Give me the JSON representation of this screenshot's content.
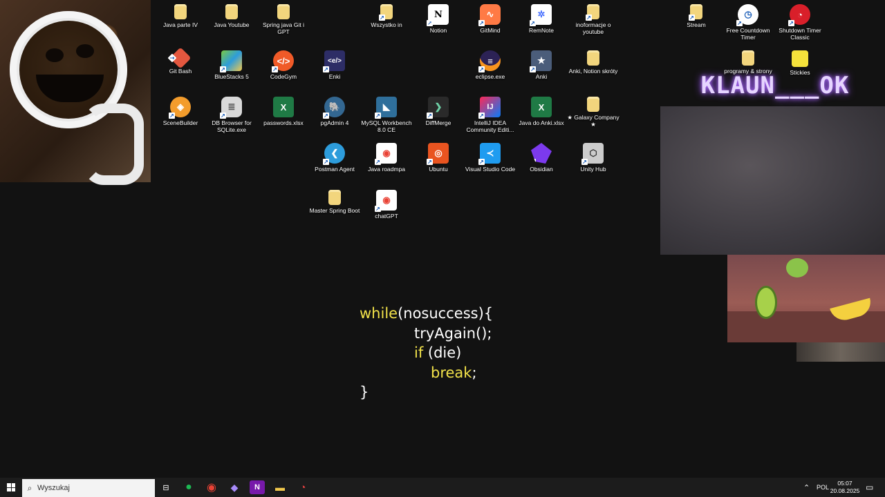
{
  "desktop": {
    "icons": [
      {
        "label": "Java parte IV",
        "color": "#f2d57d"
      },
      {
        "label": "Java Youtube",
        "color": "#f2d57d"
      },
      {
        "label": "Spring java Git i GPT",
        "color": "#f2d57d"
      },
      {
        "label": "Wszystko in",
        "color": "#f2d57d"
      },
      {
        "label": "Notion",
        "color": "#ffffff"
      },
      {
        "label": "GitMind",
        "color": "#ff7a45"
      },
      {
        "label": "RemNote",
        "color": "#ffffff"
      },
      {
        "label": "inoformacje o youtube",
        "color": "#f2d57d"
      },
      {
        "label": "Stream",
        "color": "#f2d57d"
      },
      {
        "label": "Free Countdown Timer",
        "color": "#ffffff"
      },
      {
        "label": "Shutdown Timer Classic",
        "color": "#d91f2a"
      },
      {
        "label": "Git Bash",
        "color": "#e3573f"
      },
      {
        "label": "BlueStacks 5",
        "color": "#7ac943"
      },
      {
        "label": "CodeGym",
        "color": "#f05a28"
      },
      {
        "label": "Enki",
        "color": "#2d2d66"
      },
      {
        "label": "eclipse.exe",
        "color": "#2c2255"
      },
      {
        "label": "Anki",
        "color": "#4b5d7a"
      },
      {
        "label": "Anki, Notion skróty",
        "color": "#f2d57d"
      },
      {
        "label": "programy & strony",
        "color": "#f2d57d"
      },
      {
        "label": "Stickies",
        "color": "#f5e23b"
      },
      {
        "label": "SceneBuilder",
        "color": "#f39c2c"
      },
      {
        "label": "DB Browser for SQLite.exe",
        "color": "#d9d9d9"
      },
      {
        "label": "passwords.xlsx",
        "color": "#1f7a45"
      },
      {
        "label": "pgAdmin 4",
        "color": "#336791"
      },
      {
        "label": "MySQL Workbench 8.0 CE",
        "color": "#2f6f9b"
      },
      {
        "label": "DiffMerge",
        "color": "#444444"
      },
      {
        "label": "IntelliJ IDEA Community Editi...",
        "color": "#fe2857"
      },
      {
        "label": "Java do Anki.xlsx",
        "color": "#1f7a45"
      },
      {
        "label": "★ Galaxy Company ★",
        "color": "#f2d57d"
      },
      {
        "label": "Postman Agent",
        "color": "#2d9cdb"
      },
      {
        "label": "Java roadmpa",
        "color": "#ffffff"
      },
      {
        "label": "Ubuntu",
        "color": "#e95420"
      },
      {
        "label": "Visual Studio Code",
        "color": "#1f9cf0"
      },
      {
        "label": "Obsidian",
        "color": "#7c3aed"
      },
      {
        "label": "Unity Hub",
        "color": "#cccccc"
      },
      {
        "label": "Master Spring Boot",
        "color": "#f2d57d"
      },
      {
        "label": "chatGPT",
        "color": "#ffffff"
      }
    ]
  },
  "overlay": {
    "neon_text": "KLAUN___OK"
  },
  "code": {
    "l1_kw": "while",
    "l1_rest": "(nosuccess){",
    "l2": "tryAgain();",
    "l3_kw": "if",
    "l3_rest": " (die)",
    "l4_kw": "break",
    "l4_rest": ";",
    "l5": "}"
  },
  "taskbar": {
    "search_placeholder": "Wyszukaj",
    "lang": "POL",
    "time": "05:07",
    "date": "20.08.2025",
    "apps": [
      {
        "name": "task-view",
        "glyph": "⊟",
        "color": "#ffffff"
      },
      {
        "name": "spotify",
        "glyph": "●",
        "color": "#1db954"
      },
      {
        "name": "chrome",
        "glyph": "◉",
        "color": "#e94235"
      },
      {
        "name": "obsidian",
        "glyph": "◆",
        "color": "#a78bfa"
      },
      {
        "name": "onenote",
        "glyph": "N",
        "color": "#7719aa"
      },
      {
        "name": "file-explorer",
        "glyph": "▬",
        "color": "#f2c94c"
      },
      {
        "name": "speedometer",
        "glyph": "◔",
        "color": "#e04040"
      }
    ]
  }
}
